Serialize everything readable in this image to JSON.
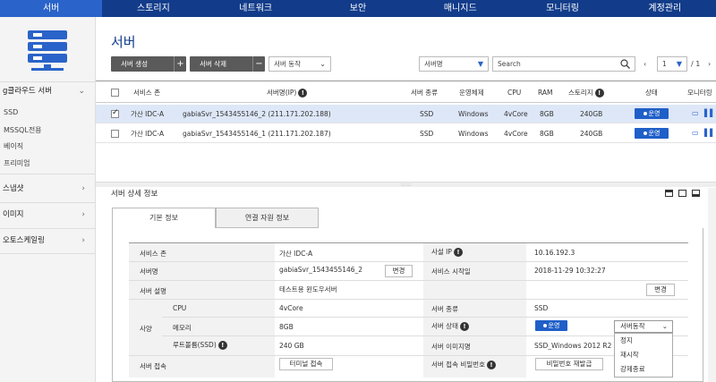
{
  "topnav": [
    "서버",
    "스토리지",
    "네트워크",
    "보안",
    "매니지드",
    "모니터링",
    "계정관리"
  ],
  "sidebar": {
    "sections": [
      {
        "label": "g클라우드 서버",
        "chevron": "⌄"
      },
      {
        "label": "스냅샷",
        "chevron": "›"
      },
      {
        "label": "이미지",
        "chevron": "›"
      },
      {
        "label": "오토스케일링",
        "chevron": "›"
      }
    ],
    "sub_items": [
      "SSD",
      "MSSQL전용",
      "베이직",
      "프리미엄"
    ]
  },
  "page_title": "서버",
  "toolbar": {
    "create_label": "서버 생성",
    "create_sym": "+",
    "delete_label": "서버 삭제",
    "delete_sym": "−",
    "action_label": "서버 동작",
    "filter_label": "서버명",
    "search_placeholder": "Search",
    "page_current": "1",
    "page_total": "/ 1",
    "prev": "‹",
    "next": "›"
  },
  "table": {
    "headers": [
      "서비스 존",
      "서버명(IP)",
      "서버 종류",
      "운영체제",
      "CPU",
      "RAM",
      "스토리지",
      "상태",
      "모니터링"
    ],
    "rows": [
      {
        "zone": "가산 IDC-A",
        "name": "gabiaSvr_1543455146_2 (211.171.202.188)",
        "type": "SSD",
        "os": "Windows",
        "cpu": "4vCore",
        "ram": "8GB",
        "storage": "240GB",
        "status": "운영",
        "checked": true
      },
      {
        "zone": "가산 IDC-A",
        "name": "gabiaSvr_1543455146_1 (211.171.202.187)",
        "type": "SSD",
        "os": "Windows",
        "cpu": "4vCore",
        "ram": "8GB",
        "storage": "240GB",
        "status": "운영",
        "checked": false
      }
    ]
  },
  "detail": {
    "title": "서버 상세 정보",
    "tabs": [
      "기본 정보",
      "연결 자원 정보"
    ],
    "labels": {
      "zone": "서비스 존",
      "name": "서버명",
      "desc": "서버 설명",
      "spec": "사양",
      "cpu": "CPU",
      "memory": "메모리",
      "root": "루트볼륨(SSD)",
      "access": "서버 접속",
      "private_ip": "사설 IP",
      "start": "서비스 시작일",
      "type": "서버 종류",
      "status": "서버 상태",
      "image": "서버 이미지명",
      "access_pw": "서버 접속 비밀번호"
    },
    "values": {
      "zone": "가산 IDC-A",
      "name": "gabiaSvr_1543455146_2",
      "desc": "테스트용 윈도우서버",
      "cpu": "4vCore",
      "memory": "8GB",
      "root": "240 GB",
      "private_ip": "10.16.192.3",
      "start": "2018-11-29 10:32:27",
      "type": "SSD",
      "status": "운영",
      "image": "SSD_Windows 2012 R2 S"
    },
    "buttons": {
      "change": "변경",
      "change2": "변경",
      "terminal": "터미널 접속",
      "pw_reissue": "비밀번호 재발급"
    },
    "action_dropdown": "서버동작",
    "action_menu": [
      "정지",
      "재시작",
      "강제종료"
    ]
  }
}
